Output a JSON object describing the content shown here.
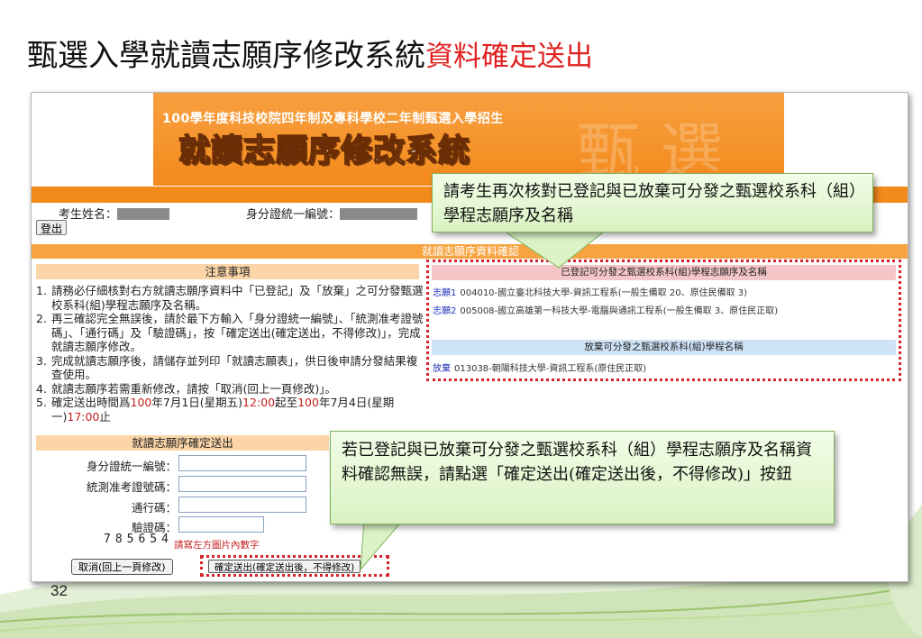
{
  "slide": {
    "title_main": "甄選入學就讀志願序修改系統",
    "title_accent": "資料確定送出",
    "page_number": "32"
  },
  "banner": {
    "subtitle": "100學年度科技校院四年制及專科學校二年制甄選入學招生",
    "title": "就讀志願序修改系統",
    "watermark": "甄 選"
  },
  "student": {
    "name_label": "考生姓名：",
    "id_label": "身分證統一編號：",
    "logout_label": "登出"
  },
  "section_title": "就讀志願序資料確認",
  "notice": {
    "heading": "注意事項",
    "items": [
      {
        "num": "1.",
        "text": "請務必仔細核對右方就讀志願序資料中「已登記」及「放棄」之可分發甄選校系科(組)學程志願序及名稱。"
      },
      {
        "num": "2.",
        "text": "再三確認完全無誤後，請於最下方輸入「身分證統一編號」、「統測准考證號碼」、「通行碼」及「驗證碼」，按「確定送出(確定送出，不得修改)」，完成就讀志願序修改。"
      },
      {
        "num": "3.",
        "text": "完成就讀志願序後，請儲存並列印「就讀志願表」，供日後申請分發結果複查使用。"
      },
      {
        "num": "4.",
        "text": "就讀志願序若需重新修改，請按「取消(回上一頁修改)」。"
      }
    ],
    "item5": {
      "num": "5.",
      "prefix": "確定送出時間爲",
      "date1": "100",
      "mid1": "年7月1日(星期五)",
      "time1": "12:00",
      "mid2": "起至",
      "date2": "100",
      "mid3": "年7月4日(星期一)",
      "time2": "17:00",
      "suffix": "止"
    }
  },
  "registered": {
    "heading": "已登記可分發之甄選校系科(組)學程志願序及名稱",
    "rows": [
      {
        "label": "志願1",
        "detail": "004010-國立臺北科技大學-資訊工程系(一般生備取 20、原住民備取 3)"
      },
      {
        "label": "志願2",
        "detail": "005008-國立高雄第一科技大學-電腦與通訊工程系(一般生備取 3、原住民正取)"
      }
    ]
  },
  "abandoned": {
    "heading": "放棄可分發之甄選校系科(組)學程名稱",
    "rows": [
      {
        "label": "放棄",
        "detail": "013038-朝陽科技大學-資訊工程系(原住民正取)"
      }
    ]
  },
  "confirm": {
    "heading": "就讀志願序確定送出",
    "id_label": "身分證統一編號：",
    "exam_label": "統測准考證號碼：",
    "pass_label": "通行碼：",
    "verify_label": "驗證碼：",
    "captcha": "785654",
    "captcha_hint": "請寫左方圖片內數字",
    "cancel_label": "取消(回上一頁修改)",
    "submit_label": "確定送出(確定送出後，不得修改)"
  },
  "callouts": {
    "check": "請考生再次核對已登記與已放棄可分發之甄選校系科（組）學程志願序及名稱",
    "submit": "若已登記與已放棄可分發之甄選校系科（組）學程志願序及名稱資料確認無誤，請點選「確定送出(確定送出後，不得修改)」按鈕"
  },
  "colors": {
    "accent_red": "#e02020",
    "banner_orange": "#f38a1c",
    "callout_green": "#d9f2c2",
    "highlight_red": "#d8232a"
  }
}
